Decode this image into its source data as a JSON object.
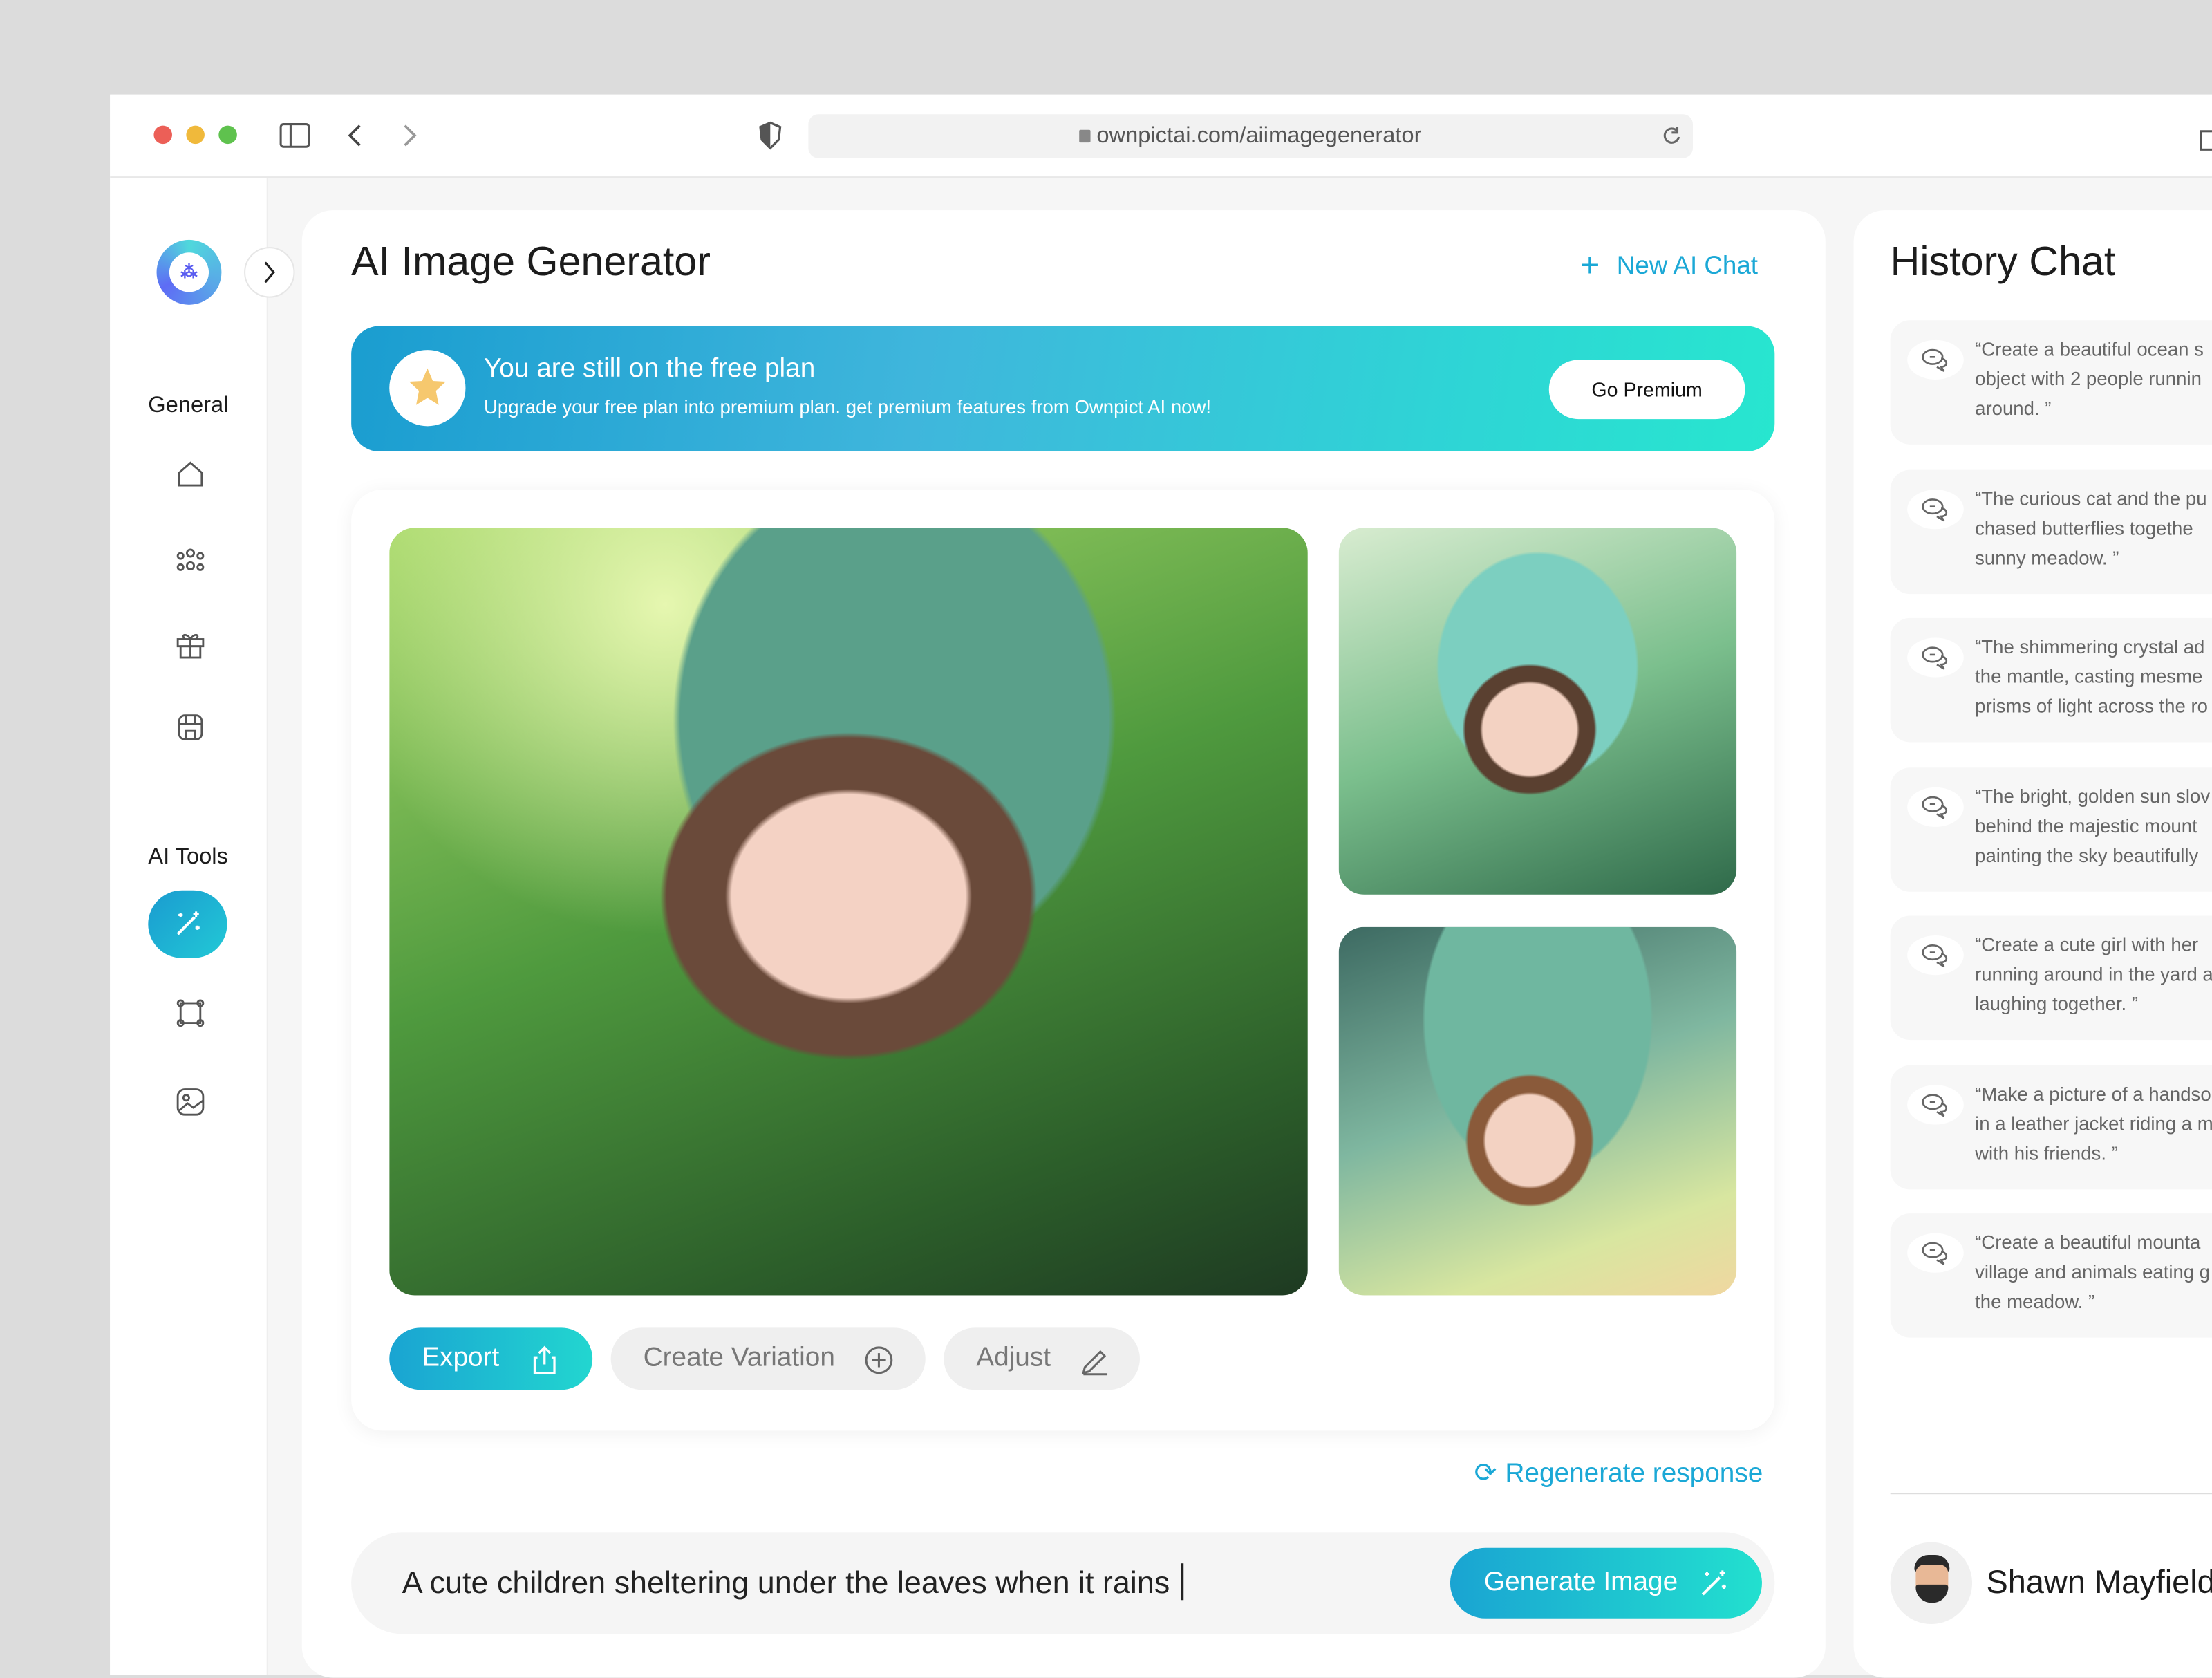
{
  "browser": {
    "url": "ownpictai.com/aiimagegenerator",
    "traffic_lights": [
      "#ec5f57",
      "#f0b93b",
      "#5fc24e"
    ]
  },
  "sidebar": {
    "sections": [
      {
        "label": "General",
        "items": [
          "home-icon",
          "community-icon",
          "gift-icon",
          "store-icon"
        ]
      },
      {
        "label": "AI Tools",
        "items": [
          "magic-wand-icon",
          "crop-frame-icon",
          "image-icon"
        ]
      }
    ],
    "active_item": "magic-wand-icon"
  },
  "main": {
    "title": "AI Image Generator",
    "new_chat_label": "New AI Chat",
    "banner": {
      "title": "You are still on the free plan",
      "subtitle": "Upgrade your free plan into premium plan. get premium features from Ownpict AI now!",
      "button": "Go Premium"
    },
    "actions": {
      "export": "Export",
      "variation": "Create Variation",
      "adjust": "Adjust"
    },
    "regenerate_label": "Regenerate response",
    "prompt_value": "A cute children sheltering under the leaves when it rains",
    "generate_label": "Generate Image"
  },
  "history": {
    "title": "History Chat",
    "items": [
      "“Create a beautiful ocean s\nobject with 2 people runnin\naround. ”",
      "“The curious cat and the pu\nchased butterflies togethe\nsunny meadow. ”",
      "“The shimmering crystal ad\nthe mantle, casting mesme\nprisms of light across the ro",
      "“The bright, golden sun slov\nbehind the majestic mount\npainting the sky beautifully",
      "“Create a cute girl with her \nrunning around in the yard a\nlaughing together. ”",
      "“Make a picture of a handso\nin a leather jacket riding a m\nwith his friends. ”",
      "“Create a beautiful mounta\nvillage and animals eating g\nthe meadow. ”"
    ],
    "user_name": "Shawn Mayfield"
  },
  "colors": {
    "accent": "#1ba8d6",
    "accent_2": "#22e3cf",
    "star": "#f6c86e"
  }
}
